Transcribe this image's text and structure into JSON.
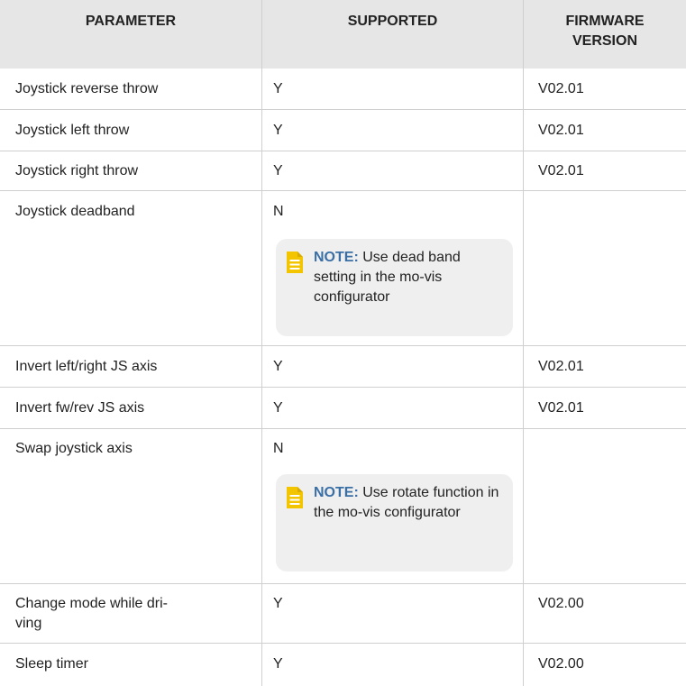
{
  "headers": {
    "parameter": "PARAMETER",
    "supported": "SUPPORTED",
    "firmware_line1": "FIRMWARE",
    "firmware_line2": "VERSION"
  },
  "rows": [
    {
      "parameter": "Joystick reverse throw",
      "supported": "Y",
      "firmware": "V02.01"
    },
    {
      "parameter": "Joystick left throw",
      "supported": "Y",
      "firmware": "V02.01"
    },
    {
      "parameter": "Joystick right throw",
      "supported": "Y",
      "firmware": "V02.01"
    },
    {
      "parameter": "Joystick deadband",
      "supported": "N",
      "firmware": "",
      "note": {
        "label": "NOTE:",
        "text": "Use dead band setting in the mo-vis configurator"
      }
    },
    {
      "parameter": "Invert left/right JS axis",
      "supported": "Y",
      "firmware": "V02.01"
    },
    {
      "parameter": "Invert fw/rev JS axis",
      "supported": "Y",
      "firmware": "V02.01"
    },
    {
      "parameter": "Swap joystick axis",
      "supported": "N",
      "firmware": "",
      "note": {
        "label": "NOTE:",
        "text": "Use rotate function in the mo-vis configurator"
      }
    },
    {
      "parameter_line1": "Change mode while dri-",
      "parameter_line2": "ving",
      "supported": "Y",
      "firmware": "V02.00"
    },
    {
      "parameter": "Sleep timer",
      "supported": "Y",
      "firmware": "V02.00"
    }
  ],
  "colors": {
    "header_bg": "#e6e6e6",
    "note_bg": "#efefef",
    "note_label": "#3a6fa6",
    "note_icon": "#f2c500"
  }
}
